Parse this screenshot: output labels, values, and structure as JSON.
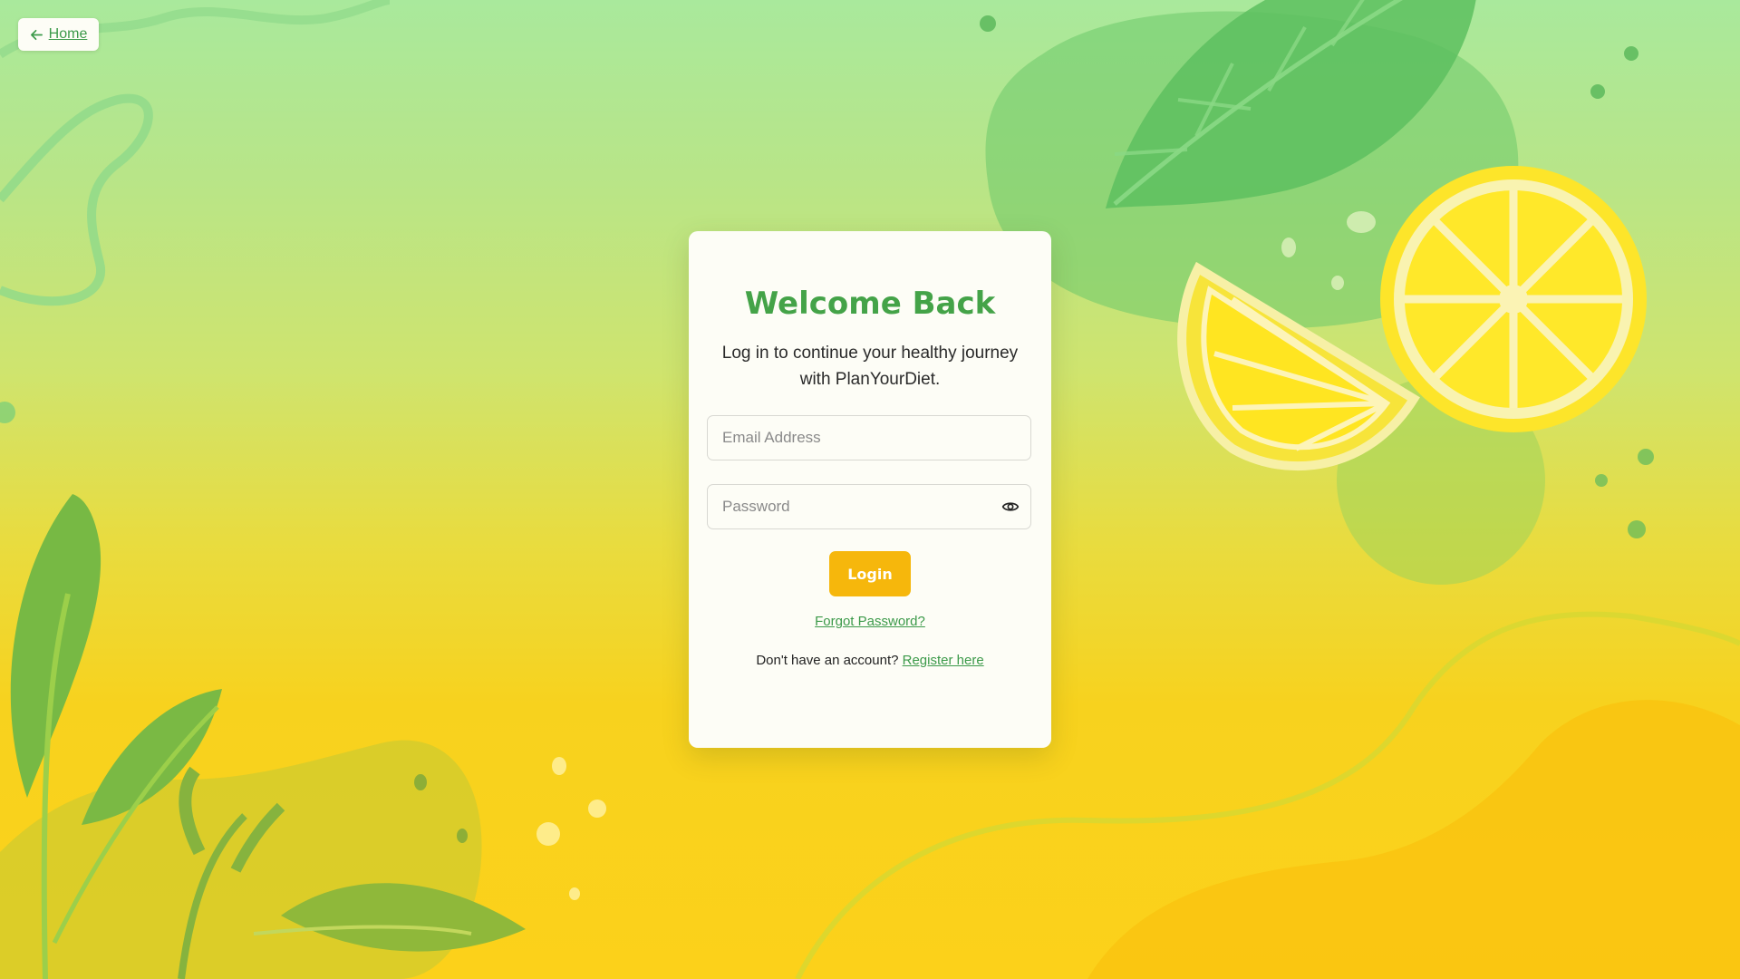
{
  "nav": {
    "home_label": "Home",
    "home_icon": "arrow-left-icon"
  },
  "login_card": {
    "title": "Welcome Back",
    "subtitle": "Log in to continue your healthy journey with PlanYourDiet.",
    "email_placeholder": "Email Address",
    "email_value": "",
    "password_placeholder": "Password",
    "password_value": "",
    "password_toggle_icon": "eye-icon",
    "login_label": "Login",
    "forgot_password_label": "Forgot Password?",
    "register_prompt": "Don't have an account?",
    "register_link_label": "Register here"
  },
  "colors": {
    "brand_green": "#44a348",
    "link_green": "#3c9a4a",
    "button_yellow": "#f6b70c",
    "card_background": "#fdfdf6"
  },
  "background": {
    "decoration_icons": [
      "lemon-slice-icon",
      "lemon-wedge-icon",
      "leaf-icon",
      "plant-sprig-icon"
    ]
  }
}
